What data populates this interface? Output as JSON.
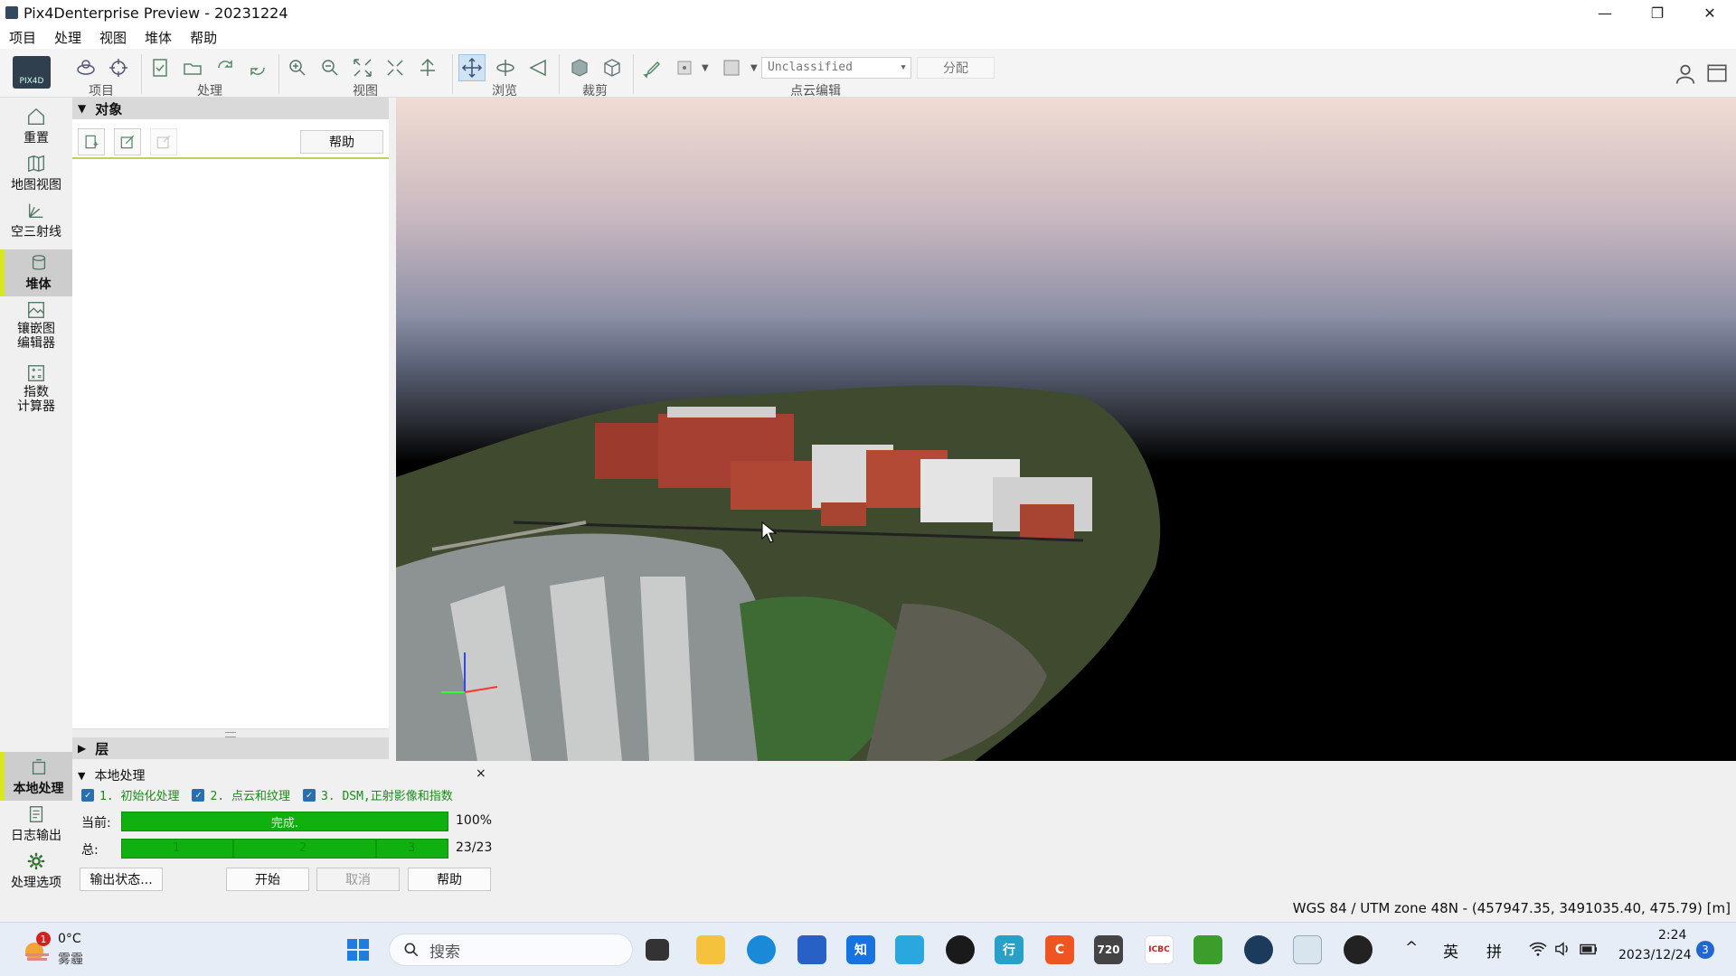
{
  "window": {
    "title": "Pix4Denterprise Preview - 20231224",
    "minimize": "—",
    "restore": "❐",
    "close": "✕"
  },
  "menu": [
    "项目",
    "处理",
    "视图",
    "堆体",
    "帮助"
  ],
  "toolbar": {
    "logo": "PIX4D",
    "groups": [
      "项目",
      "处理",
      "视图",
      "浏览",
      "裁剪",
      "点云编辑"
    ],
    "class_select": "Unclassified",
    "assign_button": "分配",
    "active_tool": "navigate-icon"
  },
  "left_nav": {
    "items": [
      "重置",
      "地图视图",
      "空三射线",
      "堆体",
      "镶嵌图\n编辑器",
      "指数\n计算器"
    ],
    "active": "堆体",
    "bottom_items": [
      "本地处理",
      "日志输出",
      "处理选项"
    ]
  },
  "objects_panel": {
    "title": "对象",
    "help_button": "帮助"
  },
  "layers_panel": {
    "title": "层"
  },
  "processing": {
    "title": "本地处理",
    "close": "×",
    "steps": [
      "1. 初始化处理",
      "2. 点云和纹理",
      "3. DSM,正射影像和指数"
    ],
    "current_label": "当前:",
    "current_bar_text": "完成.",
    "current_value": "100%",
    "current_progress": 1.0,
    "total_label": "总:",
    "total_segments": [
      "1",
      "2",
      "3"
    ],
    "total_value": "23/23",
    "total_progress": 1.0,
    "buttons": {
      "output_status": "输出状态...",
      "start": "开始",
      "cancel": "取消",
      "help": "帮助"
    }
  },
  "status_bar": {
    "coords": "WGS 84 / UTM zone 48N - (457947.35, 3491035.40, 475.79) [m]"
  },
  "taskbar": {
    "weather_temp": "0°C",
    "weather_desc": "雾霾",
    "weather_badge": "1",
    "search_placeholder": "搜索",
    "apps": [
      "start",
      "search",
      "task-view",
      "file-explorer",
      "edge",
      "store",
      "zhihu",
      "bilibili",
      "github",
      "xing",
      "c-app",
      "720",
      "icbc",
      "minecraft",
      "steam",
      "pix4d",
      "obs"
    ],
    "app_labels": {
      "zhihu": "知",
      "xing": "行",
      "c-app": "C",
      "720": "720",
      "icbc": "ICBC"
    },
    "tray": {
      "chevron": "^",
      "ime_lang": "英",
      "ime_mode": "拼",
      "time": "2:24",
      "date": "2023/12/24",
      "notif_count": "3"
    }
  },
  "colors": {
    "progress_green": "#0fb00f",
    "active_nav_marker": "#d8e81e",
    "accent_blue": "#2a6fb0"
  }
}
